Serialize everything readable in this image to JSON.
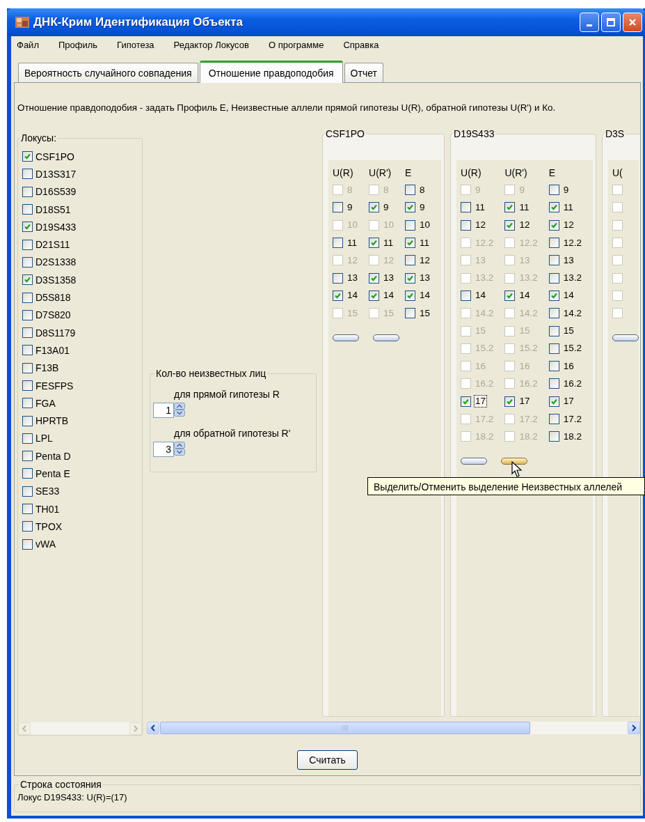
{
  "window": {
    "title": "ДНК-Крим Идентификация Объекта"
  },
  "menu": [
    "Файл",
    "Профиль",
    "Гипотеза",
    "Редактор Локусов",
    "О программе",
    "Справка"
  ],
  "tabs": [
    {
      "label": "Вероятность случайного совпадения",
      "selected": false
    },
    {
      "label": "Отношение правдоподобия",
      "selected": true
    },
    {
      "label": "Отчет",
      "selected": false
    }
  ],
  "description": "Отношение правдоподобия - задать Профиль E, Неизвестные аллели прямой гипотезы U(R), обратной гипотезы U(R') и Ко.",
  "loci": {
    "title": "Локусы:",
    "items": [
      {
        "label": "CSF1PO",
        "checked": true
      },
      {
        "label": "D13S317",
        "checked": false
      },
      {
        "label": "D16S539",
        "checked": false
      },
      {
        "label": "D18S51",
        "checked": false
      },
      {
        "label": "D19S433",
        "checked": true
      },
      {
        "label": "D21S11",
        "checked": false
      },
      {
        "label": "D2S1338",
        "checked": false
      },
      {
        "label": "D3S1358",
        "checked": true
      },
      {
        "label": "D5S818",
        "checked": false
      },
      {
        "label": "D7S820",
        "checked": false
      },
      {
        "label": "D8S1179",
        "checked": false
      },
      {
        "label": "F13A01",
        "checked": false
      },
      {
        "label": "F13B",
        "checked": false
      },
      {
        "label": "FESFPS",
        "checked": false
      },
      {
        "label": "FGA",
        "checked": false
      },
      {
        "label": "HPRTB",
        "checked": false
      },
      {
        "label": "LPL",
        "checked": false
      },
      {
        "label": "Penta D",
        "checked": false
      },
      {
        "label": "Penta E",
        "checked": false
      },
      {
        "label": "SE33",
        "checked": false
      },
      {
        "label": "TH01",
        "checked": false
      },
      {
        "label": "TPOX",
        "checked": false
      },
      {
        "label": "vWA",
        "checked": false
      }
    ]
  },
  "unknowns": {
    "title": "Кол-во неизвестных лиц",
    "fields": [
      {
        "label": "для прямой гипотезы R",
        "value": "1"
      },
      {
        "label": "для обратной гипотезы R'",
        "value": "3"
      }
    ]
  },
  "allele_panels": [
    {
      "title": "CSF1PO",
      "columns": [
        {
          "header": "U(R)",
          "alleles": [
            {
              "label": "8",
              "checked": false,
              "disabled": true,
              "focused": false
            },
            {
              "label": "9",
              "checked": false,
              "disabled": false,
              "focused": false
            },
            {
              "label": "10",
              "checked": false,
              "disabled": true,
              "focused": false
            },
            {
              "label": "11",
              "checked": false,
              "disabled": false,
              "focused": false
            },
            {
              "label": "12",
              "checked": false,
              "disabled": true,
              "focused": false
            },
            {
              "label": "13",
              "checked": false,
              "disabled": false,
              "focused": false
            },
            {
              "label": "14",
              "checked": true,
              "disabled": false,
              "focused": false
            },
            {
              "label": "15",
              "checked": false,
              "disabled": true,
              "focused": false
            }
          ]
        },
        {
          "header": "U(R')",
          "alleles": [
            {
              "label": "8",
              "checked": false,
              "disabled": true,
              "focused": false
            },
            {
              "label": "9",
              "checked": true,
              "disabled": false,
              "focused": false
            },
            {
              "label": "10",
              "checked": false,
              "disabled": true,
              "focused": false
            },
            {
              "label": "11",
              "checked": true,
              "disabled": false,
              "focused": false
            },
            {
              "label": "12",
              "checked": false,
              "disabled": true,
              "focused": false
            },
            {
              "label": "13",
              "checked": true,
              "disabled": false,
              "focused": false
            },
            {
              "label": "14",
              "checked": true,
              "disabled": false,
              "focused": false
            },
            {
              "label": "15",
              "checked": false,
              "disabled": true,
              "focused": false
            }
          ]
        },
        {
          "header": "E",
          "alleles": [
            {
              "label": "8",
              "checked": false,
              "disabled": false,
              "focused": false
            },
            {
              "label": "9",
              "checked": true,
              "disabled": false,
              "focused": false
            },
            {
              "label": "10",
              "checked": false,
              "disabled": false,
              "focused": false
            },
            {
              "label": "11",
              "checked": true,
              "disabled": false,
              "focused": false
            },
            {
              "label": "12",
              "checked": false,
              "disabled": false,
              "focused": false
            },
            {
              "label": "13",
              "checked": true,
              "disabled": false,
              "focused": false
            },
            {
              "label": "14",
              "checked": true,
              "disabled": false,
              "focused": false
            },
            {
              "label": "15",
              "checked": false,
              "disabled": false,
              "focused": false
            }
          ]
        }
      ],
      "buttons": [
        {
          "hover": false
        },
        {
          "hover": false
        }
      ]
    },
    {
      "title": "D19S433",
      "columns": [
        {
          "header": "U(R)",
          "alleles": [
            {
              "label": "9",
              "checked": false,
              "disabled": true,
              "focused": false
            },
            {
              "label": "11",
              "checked": false,
              "disabled": false,
              "focused": false
            },
            {
              "label": "12",
              "checked": false,
              "disabled": false,
              "focused": false
            },
            {
              "label": "12.2",
              "checked": false,
              "disabled": true,
              "focused": false
            },
            {
              "label": "13",
              "checked": false,
              "disabled": true,
              "focused": false
            },
            {
              "label": "13.2",
              "checked": false,
              "disabled": true,
              "focused": false
            },
            {
              "label": "14",
              "checked": false,
              "disabled": false,
              "focused": false
            },
            {
              "label": "14.2",
              "checked": false,
              "disabled": true,
              "focused": false
            },
            {
              "label": "15",
              "checked": false,
              "disabled": true,
              "focused": false
            },
            {
              "label": "15.2",
              "checked": false,
              "disabled": true,
              "focused": false
            },
            {
              "label": "16",
              "checked": false,
              "disabled": true,
              "focused": false
            },
            {
              "label": "16.2",
              "checked": false,
              "disabled": true,
              "focused": false
            },
            {
              "label": "17",
              "checked": true,
              "disabled": false,
              "focused": true
            },
            {
              "label": "17.2",
              "checked": false,
              "disabled": true,
              "focused": false
            },
            {
              "label": "18.2",
              "checked": false,
              "disabled": true,
              "focused": false
            }
          ]
        },
        {
          "header": "U(R')",
          "alleles": [
            {
              "label": "9",
              "checked": false,
              "disabled": true,
              "focused": false
            },
            {
              "label": "11",
              "checked": true,
              "disabled": false,
              "focused": false
            },
            {
              "label": "12",
              "checked": true,
              "disabled": false,
              "focused": false
            },
            {
              "label": "12.2",
              "checked": false,
              "disabled": true,
              "focused": false
            },
            {
              "label": "13",
              "checked": false,
              "disabled": true,
              "focused": false
            },
            {
              "label": "13.2",
              "checked": false,
              "disabled": true,
              "focused": false
            },
            {
              "label": "14",
              "checked": true,
              "disabled": false,
              "focused": false
            },
            {
              "label": "14.2",
              "checked": false,
              "disabled": true,
              "focused": false
            },
            {
              "label": "15",
              "checked": false,
              "disabled": true,
              "focused": false
            },
            {
              "label": "15.2",
              "checked": false,
              "disabled": true,
              "focused": false
            },
            {
              "label": "16",
              "checked": false,
              "disabled": true,
              "focused": false
            },
            {
              "label": "16.2",
              "checked": false,
              "disabled": true,
              "focused": false
            },
            {
              "label": "17",
              "checked": true,
              "disabled": false,
              "focused": false
            },
            {
              "label": "17.2",
              "checked": false,
              "disabled": true,
              "focused": false
            },
            {
              "label": "18.2",
              "checked": false,
              "disabled": true,
              "focused": false
            }
          ]
        },
        {
          "header": "E",
          "alleles": [
            {
              "label": "9",
              "checked": false,
              "disabled": false,
              "focused": false
            },
            {
              "label": "11",
              "checked": true,
              "disabled": false,
              "focused": false
            },
            {
              "label": "12",
              "checked": true,
              "disabled": false,
              "focused": false
            },
            {
              "label": "12.2",
              "checked": false,
              "disabled": false,
              "focused": false
            },
            {
              "label": "13",
              "checked": false,
              "disabled": false,
              "focused": false
            },
            {
              "label": "13.2",
              "checked": false,
              "disabled": false,
              "focused": false
            },
            {
              "label": "14",
              "checked": true,
              "disabled": false,
              "focused": false
            },
            {
              "label": "14.2",
              "checked": false,
              "disabled": false,
              "focused": false
            },
            {
              "label": "15",
              "checked": false,
              "disabled": false,
              "focused": false
            },
            {
              "label": "15.2",
              "checked": false,
              "disabled": false,
              "focused": false
            },
            {
              "label": "16",
              "checked": false,
              "disabled": false,
              "focused": false
            },
            {
              "label": "16.2",
              "checked": false,
              "disabled": false,
              "focused": false
            },
            {
              "label": "17",
              "checked": true,
              "disabled": false,
              "focused": false
            },
            {
              "label": "17.2",
              "checked": false,
              "disabled": false,
              "focused": false
            },
            {
              "label": "18.2",
              "checked": false,
              "disabled": false,
              "focused": false
            }
          ]
        }
      ],
      "buttons": [
        {
          "hover": false
        },
        {
          "hover": true
        }
      ]
    },
    {
      "title": "D3S",
      "columns": [
        {
          "header": "U(",
          "alleles": [
            {
              "checked": false,
              "disabled": true
            },
            {
              "checked": false,
              "disabled": true
            },
            {
              "checked": false,
              "disabled": true
            },
            {
              "checked": false,
              "disabled": true
            },
            {
              "checked": false,
              "disabled": true
            },
            {
              "checked": false,
              "disabled": true
            },
            {
              "checked": false,
              "disabled": true
            },
            {
              "checked": false,
              "disabled": true
            }
          ]
        }
      ],
      "buttons": [
        {
          "hover": false
        }
      ]
    }
  ],
  "tooltip": "Выделить/Отменить выделение Неизвестных аллелей",
  "calculate_button": "Считать",
  "status_bar": {
    "title": "Строка состояния",
    "text": "Локус D19S433: U(R)=(17)"
  }
}
